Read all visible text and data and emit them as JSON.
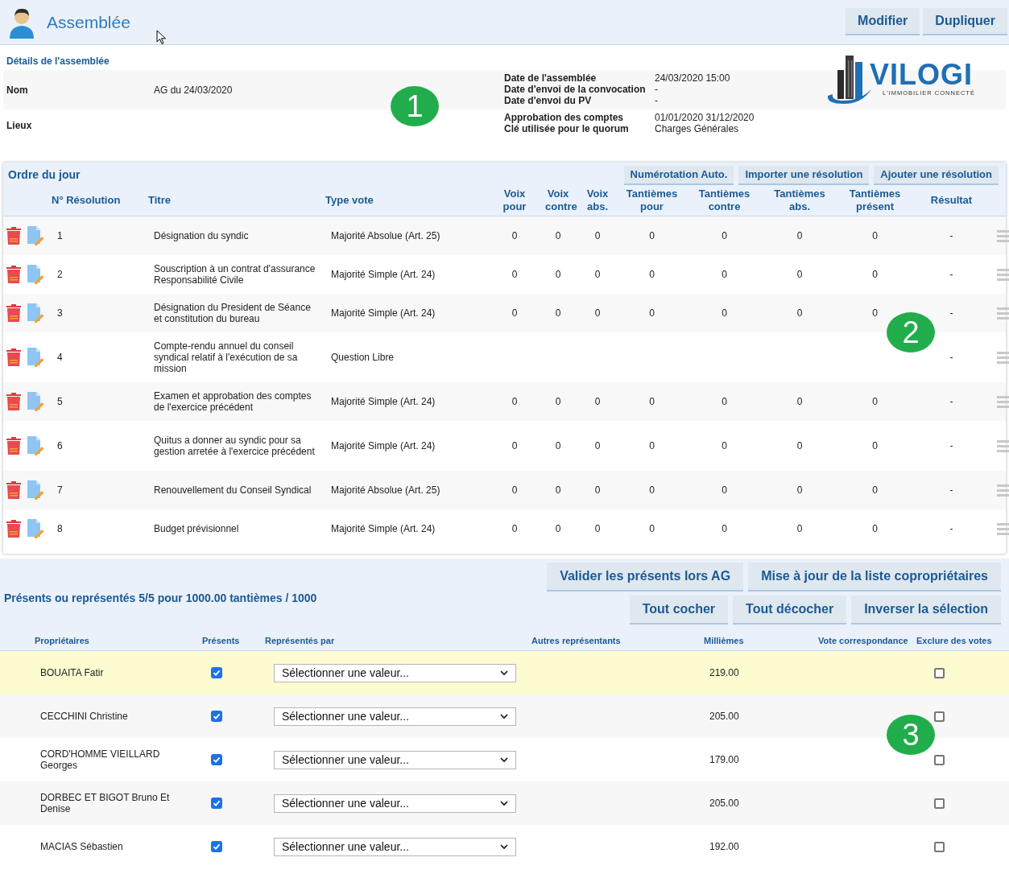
{
  "header": {
    "title": "Assemblée",
    "buttons": [
      "Modifier",
      "Dupliquer"
    ]
  },
  "details": {
    "heading": "Détails de l'assemblée",
    "rows": [
      {
        "label": "Nom",
        "value": "AG du 24/03/2020",
        "extra": [
          {
            "label": "Date de l'assemblée",
            "value": "24/03/2020 15:00"
          },
          {
            "label": "Date d'envoi de la convocation",
            "value": "-"
          },
          {
            "label": "Date d'envoi du PV",
            "value": "-"
          }
        ]
      },
      {
        "label": "Lieux",
        "extra": [
          {
            "label": "Approbation des comptes",
            "value": "01/01/2020 31/12/2020"
          },
          {
            "label": "Clé utilisée pour le quorum",
            "value": "Charges Générales"
          }
        ]
      }
    ],
    "logo": {
      "name": "VILOGI",
      "tagline": "L'IMMOBILIER CONNECTÉ"
    }
  },
  "agenda": {
    "title": "Ordre du jour",
    "actions": [
      "Numérotation Auto.",
      "Importer une résolution",
      "Ajouter une résolution"
    ],
    "columns": [
      "N° Résolution",
      "Titre",
      "Type vote",
      "Voix pour",
      "Voix contre",
      "Voix abs.",
      "Tantièmes pour",
      "Tantièmes contre",
      "Tantièmes abs.",
      "Tantièmes présent",
      "Résultat"
    ],
    "rows": [
      {
        "number": "1",
        "title": "Désignation du syndic",
        "vote_type": "Majorité Absolue (Art. 25)",
        "values": [
          "0",
          "0",
          "0",
          "0",
          "0",
          "0",
          "0"
        ],
        "result": "-"
      },
      {
        "number": "2",
        "title": "Souscription à un contrat d'assurance Responsabilité Civile",
        "vote_type": "Majorité Simple (Art. 24)",
        "values": [
          "0",
          "0",
          "0",
          "0",
          "0",
          "0",
          "0"
        ],
        "result": "-"
      },
      {
        "number": "3",
        "title": "Désignation du President de Séance et constitution du bureau",
        "vote_type": "Majorité Simple (Art. 24)",
        "values": [
          "0",
          "0",
          "0",
          "0",
          "0",
          "0",
          "0"
        ],
        "result": "-"
      },
      {
        "number": "4",
        "title": "Compte-rendu annuel du conseil syndical relatif à l'exécution de sa mission",
        "vote_type": "Question Libre",
        "result": "-"
      },
      {
        "number": "5",
        "title": "Examen et approbation des comptes de l'exercice précédent",
        "vote_type": "Majorité Simple (Art. 24)",
        "values": [
          "0",
          "0",
          "0",
          "0",
          "0",
          "0",
          "0"
        ],
        "result": "-"
      },
      {
        "number": "6",
        "title": "Quitus a donner au syndic pour sa gestion arretée à l'exercice précédent",
        "vote_type": "Majorité Simple (Art. 24)",
        "values": [
          "0",
          "0",
          "0",
          "0",
          "0",
          "0",
          "0"
        ],
        "result": "-"
      },
      {
        "number": "7",
        "title": "Renouvellement du Conseil Syndical",
        "vote_type": "Majorité Absolue (Art. 25)",
        "values": [
          "0",
          "0",
          "0",
          "0",
          "0",
          "0",
          "0"
        ],
        "result": "-"
      },
      {
        "number": "8",
        "title": "Budget prévisionnel",
        "vote_type": "Majorité Simple (Art. 24)",
        "values": [
          "0",
          "0",
          "0",
          "0",
          "0",
          "0",
          "0"
        ],
        "result": "-"
      }
    ]
  },
  "attendance": {
    "summary": "Présents ou représentés 5/5 pour 1000.00 tantièmes / 1000",
    "actions": [
      [
        "Valider les présents lors AG",
        "Mise à jour de la liste copropriétaires"
      ],
      [
        "Tout cocher",
        "Tout décocher",
        "Inverser la sélection"
      ]
    ],
    "columns": [
      "Propriétaires",
      "Présents",
      "Représentés par",
      "Autres représentants",
      "Millièmes",
      "Vote correspondance",
      "Exclure des votes"
    ],
    "rows": [
      {
        "name": "BOUAITA Fatir",
        "present": true,
        "represented_by": "Sélectionner une valeur...",
        "milliemes": "219.00",
        "excluded": false,
        "selected": true
      },
      {
        "name": "CECCHINI Christine",
        "present": true,
        "represented_by": "Sélectionner une valeur...",
        "milliemes": "205.00",
        "excluded": false,
        "selected": false
      },
      {
        "name": "CORD'HOMME VIEILLARD Georges",
        "present": true,
        "represented_by": "Sélectionner une valeur...",
        "milliemes": "179.00",
        "excluded": false,
        "selected": false
      },
      {
        "name": "DORBEC ET BIGOT Bruno Et Denise",
        "present": true,
        "represented_by": "Sélectionner une valeur...",
        "milliemes": "205.00",
        "excluded": false,
        "selected": false
      },
      {
        "name": "MACIAS Sébastien",
        "present": true,
        "represented_by": "Sélectionner une valeur...",
        "milliemes": "192.00",
        "excluded": false,
        "selected": false
      }
    ]
  },
  "callouts": [
    {
      "label": "1"
    },
    {
      "label": "2"
    },
    {
      "label": "3"
    }
  ]
}
